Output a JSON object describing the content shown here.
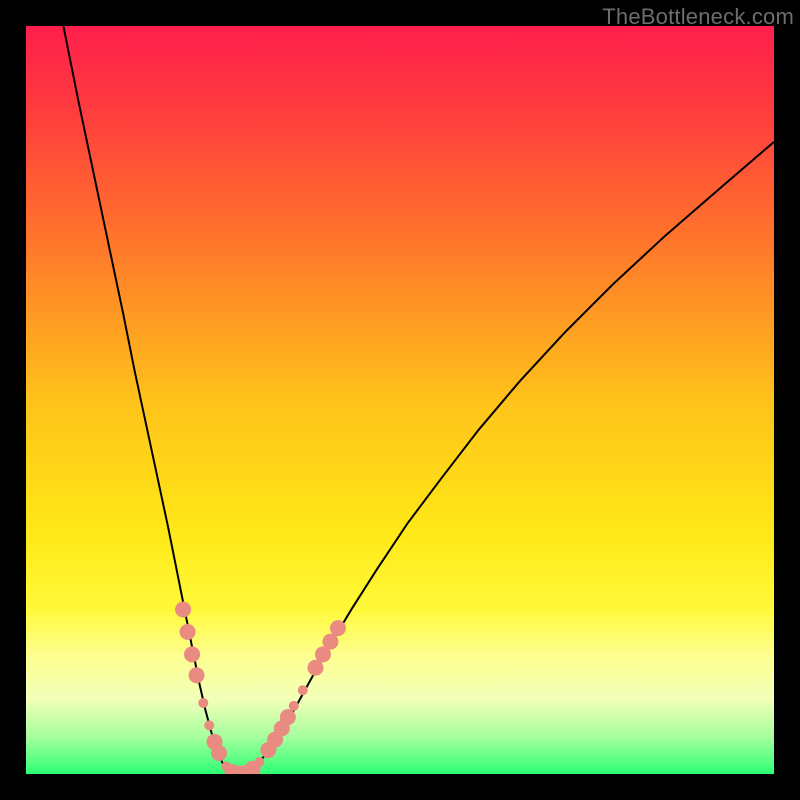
{
  "watermark": "TheBottleneck.com",
  "chart_data": {
    "type": "line",
    "title": "",
    "xlabel": "",
    "ylabel": "",
    "xlim": [
      0,
      100
    ],
    "ylim": [
      0,
      100
    ],
    "grid": false,
    "legend": false,
    "background_gradient": {
      "stops": [
        {
          "offset": 0.0,
          "color": "#ff1f4c"
        },
        {
          "offset": 0.12,
          "color": "#ff3e3d"
        },
        {
          "offset": 0.3,
          "color": "#ff7a2a"
        },
        {
          "offset": 0.5,
          "color": "#ffc21a"
        },
        {
          "offset": 0.68,
          "color": "#ffe917"
        },
        {
          "offset": 0.78,
          "color": "#fff93a"
        },
        {
          "offset": 0.84,
          "color": "#feff8e"
        },
        {
          "offset": 0.9,
          "color": "#f2ffb8"
        },
        {
          "offset": 0.95,
          "color": "#a7ff9e"
        },
        {
          "offset": 1.0,
          "color": "#2cff74"
        }
      ]
    },
    "series": [
      {
        "name": "bottleneck-curve",
        "color": "#000000",
        "width": 2,
        "x": [
          5,
          7,
          9,
          11,
          13,
          14.5,
          16,
          17.5,
          19,
          20.2,
          21.4,
          22.4,
          23.2,
          24,
          24.8,
          25.5,
          26.2,
          27,
          28,
          29,
          30,
          31.2,
          32.5,
          34,
          35.8,
          38,
          40.5,
          43.5,
          47,
          51,
          55.5,
          60.5,
          66,
          72,
          78.5,
          85.5,
          93,
          100
        ],
        "y": [
          100,
          90,
          80.5,
          71,
          61.5,
          54,
          47,
          40,
          33,
          27,
          21,
          16,
          12,
          8.5,
          5.5,
          3.2,
          1.6,
          0.5,
          0.05,
          0.05,
          0.5,
          1.6,
          3.2,
          5.5,
          8.5,
          12.5,
          17,
          22,
          27.5,
          33.5,
          39.5,
          46,
          52.5,
          59,
          65.5,
          72,
          78.5,
          84.5
        ]
      }
    ],
    "highlight_points": {
      "color": "#e98b80",
      "radius_small": 5,
      "radius_large": 8,
      "points": [
        {
          "x": 21.0,
          "y": 22.0,
          "r": 8
        },
        {
          "x": 21.6,
          "y": 19.0,
          "r": 8
        },
        {
          "x": 22.2,
          "y": 16.0,
          "r": 8
        },
        {
          "x": 22.8,
          "y": 13.2,
          "r": 8
        },
        {
          "x": 23.7,
          "y": 9.5,
          "r": 5
        },
        {
          "x": 24.5,
          "y": 6.5,
          "r": 5
        },
        {
          "x": 25.2,
          "y": 4.3,
          "r": 8
        },
        {
          "x": 25.8,
          "y": 2.8,
          "r": 8
        },
        {
          "x": 26.8,
          "y": 1.0,
          "r": 5
        },
        {
          "x": 27.6,
          "y": 0.25,
          "r": 8
        },
        {
          "x": 28.5,
          "y": 0.05,
          "r": 8
        },
        {
          "x": 29.4,
          "y": 0.15,
          "r": 8
        },
        {
          "x": 30.3,
          "y": 0.7,
          "r": 8
        },
        {
          "x": 31.2,
          "y": 1.6,
          "r": 5
        },
        {
          "x": 32.4,
          "y": 3.2,
          "r": 8
        },
        {
          "x": 33.3,
          "y": 4.6,
          "r": 8
        },
        {
          "x": 34.2,
          "y": 6.1,
          "r": 8
        },
        {
          "x": 35.0,
          "y": 7.6,
          "r": 8
        },
        {
          "x": 35.8,
          "y": 9.1,
          "r": 5
        },
        {
          "x": 37.0,
          "y": 11.2,
          "r": 5
        },
        {
          "x": 38.7,
          "y": 14.2,
          "r": 8
        },
        {
          "x": 39.7,
          "y": 16.0,
          "r": 8
        },
        {
          "x": 40.7,
          "y": 17.7,
          "r": 8
        },
        {
          "x": 41.7,
          "y": 19.5,
          "r": 8
        }
      ]
    }
  }
}
